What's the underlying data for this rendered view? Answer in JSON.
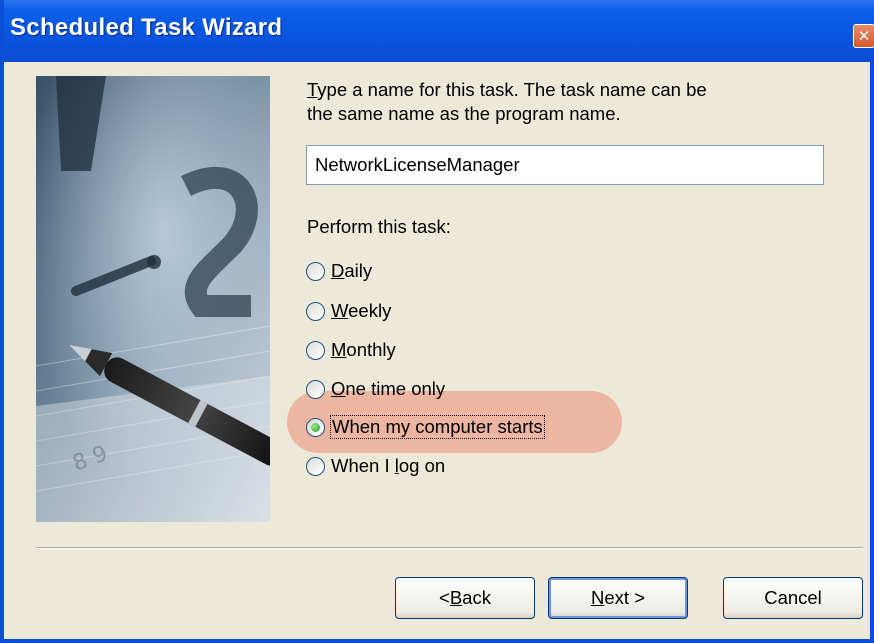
{
  "window": {
    "title": "Scheduled Task Wizard",
    "close_glyph": "✕"
  },
  "prompt": {
    "line1_first_letter": "T",
    "line1_rest": "ype a name for this task.  The task name can be",
    "line2": "the same name as the program name."
  },
  "task_name_input": {
    "value": "NetworkLicenseManager"
  },
  "perform": {
    "label": "Perform this task:",
    "options": [
      {
        "accel": "D",
        "rest": "aily",
        "checked": false
      },
      {
        "accel": "W",
        "rest": "eekly",
        "checked": false
      },
      {
        "accel": "M",
        "rest": "onthly",
        "checked": false
      },
      {
        "accel": "O",
        "rest": "ne time only",
        "checked": false
      },
      {
        "label": "When my computer starts",
        "checked": true
      },
      {
        "before": "When I ",
        "accel": "l",
        "after": "og on",
        "checked": false
      }
    ]
  },
  "buttons": {
    "back": {
      "before": "< ",
      "accel": "B",
      "rest": "ack"
    },
    "next": {
      "accel": "N",
      "rest": "ext >"
    },
    "cancel": "Cancel"
  },
  "colors": {
    "titlebar": "#0a55e0",
    "dialog_bg": "#ece9d8",
    "highlight": "#f07864",
    "radio_selected": "#21a121"
  },
  "icons": {
    "close": "close-icon",
    "wizard_art": "clock-pen-illustration"
  }
}
